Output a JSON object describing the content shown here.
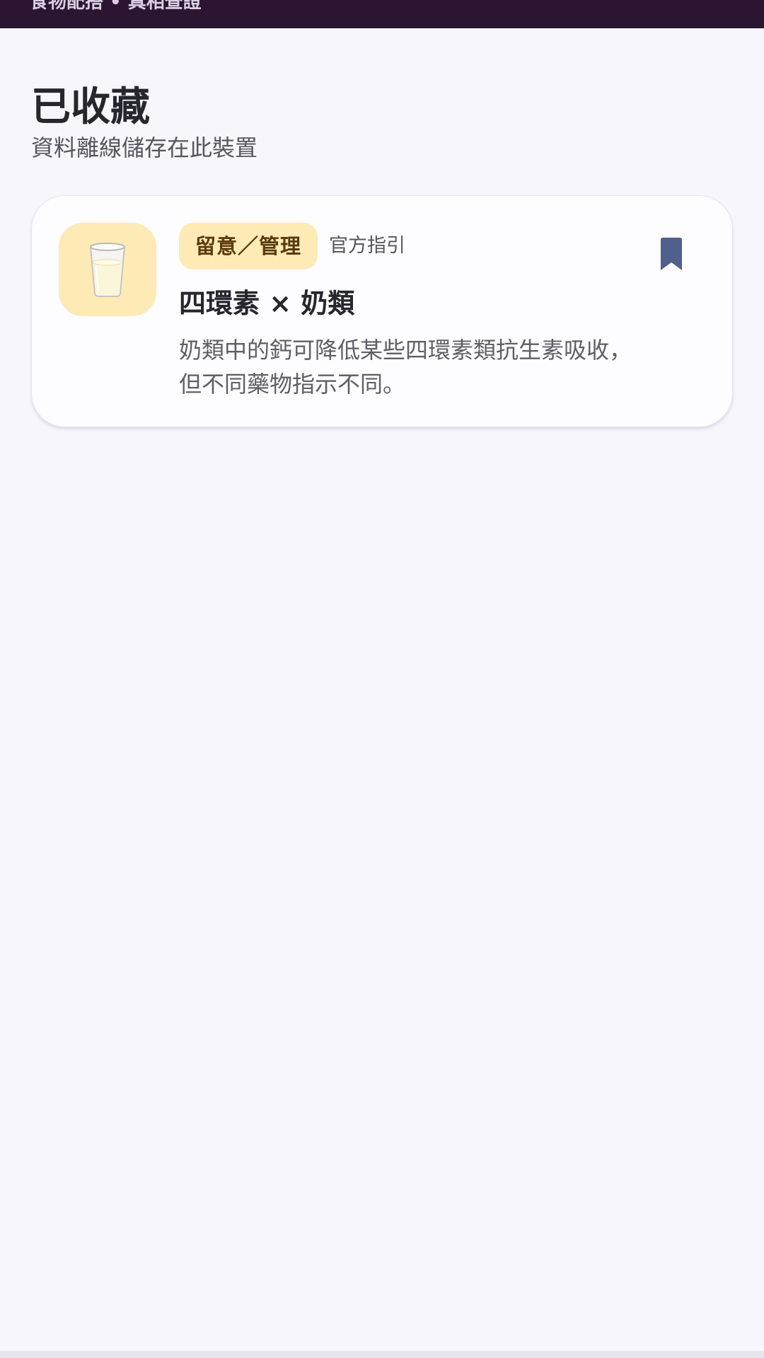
{
  "app_bar": {
    "title": "食物配搭 • 真相查證"
  },
  "page": {
    "title": "已收藏",
    "subtitle": "資料離線儲存在此裝置"
  },
  "saved_items": [
    {
      "icon": "milk-glass-icon",
      "severity": "留意／管理",
      "source": "官方指引",
      "title": "四環素 × 奶類",
      "description": "奶類中的鈣可降低某些四環素類抗生素吸收，但不同藥物指示不同。",
      "bookmarked": true,
      "bookmark_icon": "bookmark-filled-icon"
    }
  ],
  "colors": {
    "app_bar": "#2c1533",
    "background": "#f8f6fd",
    "badge_bg": "#feeab5",
    "badge_text": "#5a3a0c",
    "bookmark": "#4f5f8e"
  }
}
